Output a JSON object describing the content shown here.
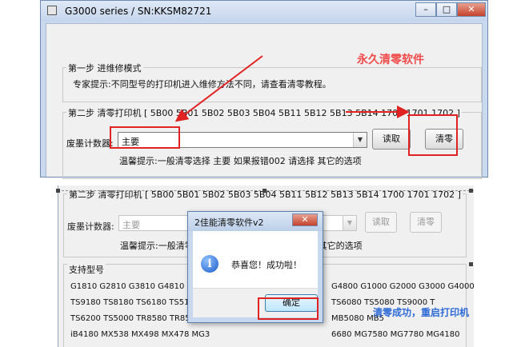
{
  "window1": {
    "title": "G3000 series / SN:KKSM82721",
    "controls": {
      "minimize": "–",
      "maximize": "□",
      "close": "✕"
    },
    "step1": {
      "title": "第一步 进维修模式",
      "hint": "专家提示:不同型号的打印机进入维修方法不同，请查看清零教程。"
    },
    "step2": {
      "title": "第二步 清零打印机 [ 5B00 5B01 5B02 5B03 5B04 5B11 5B12 5B13 5B14 1700 1701 1702 ]",
      "counter_label": "废墨计数器:",
      "counter_value": "主要",
      "read_button": "读取",
      "clear_button": "清零",
      "tip": "温馨提示:一般清零选择  主要    如果报错002  请选择  其它的选项"
    },
    "overlay_text": "永久清零软件"
  },
  "window2": {
    "step2_title": "第二步 清零打印机 [ 5B00 5B01 5B02 5B03 5B04 5B11 5B12 5B13 5B14 1700 1701 1702 ]",
    "counter_label": "废墨计数器:",
    "counter_value": "主要",
    "read_button": "读取",
    "clear_button": "清零",
    "tip": "温馨提示:一般清零选择  主要    如果报错002  请选择  其它的选项",
    "models_title": "支持型号",
    "models_lines": [
      "G1810 G2810 G3810 G4810 G1010 G",
      "TS9180 TS8180 TS6180 TS5180 TS9",
      "TS6200 TS5000 TR8580 TR8500 IX6",
      "iB4180  MX538 MX498 MX478  MG3"
    ],
    "models_lines_right": [
      "G4800 G1000 G2000 G3000 G4000",
      "TS6080 TS5080 TS9000 T",
      "MB5080 MB5",
      "6680 MG7580 MG7780  MG4180"
    ],
    "overlay_text": "清零成功，重启打印机"
  },
  "dialog": {
    "title": "2佳能清零软件v2",
    "close": "✕",
    "message": "恭喜您！成功啦！",
    "ok_button": "确定"
  },
  "colors": {
    "highlight_red": "#e02222",
    "overlay_red": "#f04b4b",
    "overlay_blue": "#2f6bd6"
  }
}
